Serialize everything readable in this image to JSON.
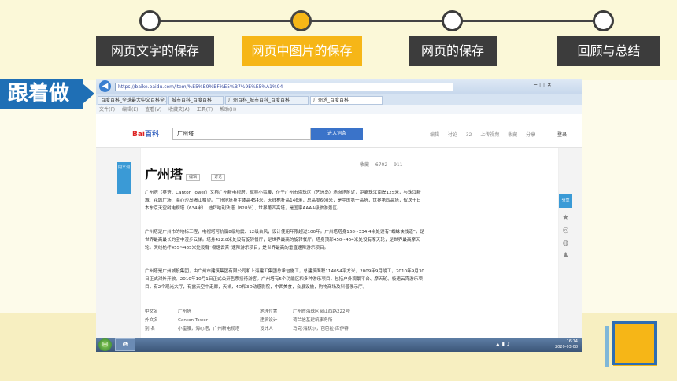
{
  "steps": [
    {
      "label": "网页文字的保存",
      "active": false
    },
    {
      "label": "网页中图片的保存",
      "active": true
    },
    {
      "label": "网页的保存",
      "active": false
    },
    {
      "label": "回顾与总结",
      "active": false
    }
  ],
  "follow_label": "跟着做",
  "browser": {
    "url": "https://baike.baidu.com/item/%E5%B9%BF%E5%B7%9E%E5%A1%94",
    "tabs": [
      "百度百科_全球最大中文百科全...",
      "城市百科_百度百科",
      "广州百科_城市百科_百度百科",
      "广州塔_百度百科"
    ],
    "menu": "文件(F)  编辑(E)  查看(V)  收藏夹(A)  工具(T)  帮助(H)"
  },
  "baike": {
    "logo_a": "Bai",
    "logo_b": "百科",
    "search_value": "广州塔",
    "enter_button": "进入词条",
    "header_options": "编辑  讨论 32  上传视频  收藏  分享",
    "login": "登录",
    "side_badge": "同义词",
    "title": "广州塔",
    "edit_btn": "编辑",
    "discuss_btn": "讨论",
    "meta": "收藏  6702  911",
    "para1": "广州塔（英语：Canton Tower）又称广州新电视塔，昵称小蛮腰，位于广州市海珠区（艺洲岛）赤岗塔附近，距离珠江南岸125米，与珠江新城、花城广场、海心沙岛隔江相望。广州塔塔身主体高454米，天线桅杆高146米，总高度600米，是中国第一高塔，世界第四高塔，仅次于日本东京天空树电视塔（634米）、迪拜哈利法塔（828米）、世界第四高塔，是国家AAAA级旅游景区。",
    "para2": "广州塔是广州市的地标工程，电视塔可抗御8级地震、12级台风，设计使用年限超过100年。广州塔塔身168~334.4米处设有“蜘蛛侠栈道”，是世界最高最长的空中漫步云梯。塔身422.8米处设有旋转餐厅，是世界最高的旋转餐厅。塔身顶部450~454米处设有摩天轮，是世界最高摩天轮。天线桅杆455~485米处设有“极速云霄”速降游乐项目，是世界最高的垂直速降游乐项目。",
    "para3": "广州塔是广州城投集团，由广州市建筑集团有限公司和上海建工集团总承包施工，总建筑面积114054平方米，2009年9月竣工，2010年9月30日正式对外开放。2010年10月1日正式公开售票接待游客。广州塔有5个功能区和多种游乐项目，包括户外观景平台、摩天轮、极速云霄游乐项目，有2个观光大厅，有露天空中走廊，天梯，4D和3D动感影院，中西美食，会展设施，购物商场及科普展示厅。",
    "info": [
      [
        "中文名",
        "广州塔",
        "地理位置",
        "广州市海珠区阅江西路222号"
      ],
      [
        "外文名",
        "Canton Tower",
        "建筑设计",
        "荷兰信基建筑事务所"
      ],
      [
        "别  名",
        "小蛮腰，海心塔，广州新电视塔",
        "设计人",
        "马克·海默尔，芭芭拉·库伊特"
      ]
    ],
    "share_label": "分享"
  },
  "taskbar": {
    "clock_time": "16:14",
    "clock_date": "2020-03-08"
  }
}
